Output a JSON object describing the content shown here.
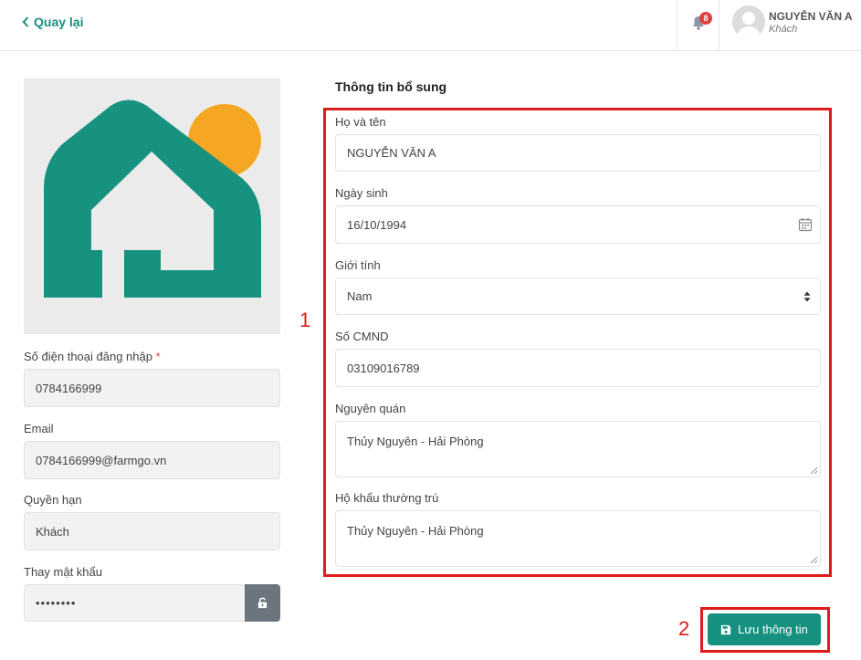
{
  "header": {
    "back_label": "Quay lại",
    "notification_count": "8",
    "user_name": "NGUYỄN VĂN A",
    "user_role": "Khách"
  },
  "left": {
    "phone": {
      "label": "Số điện thoại đăng nhập",
      "required_mark": "*",
      "value": "0784166999"
    },
    "email": {
      "label": "Email",
      "value": "0784166999@farmgo.vn"
    },
    "role": {
      "label": "Quyền hạn",
      "value": "Khách"
    },
    "password": {
      "label": "Thay mật khẩu",
      "value": "••••••••"
    }
  },
  "form": {
    "title": "Thông tin bổ sung",
    "full_name": {
      "label": "Họ và tên",
      "value": "NGUYỄN VĂN A"
    },
    "birthday": {
      "label": "Ngày sinh",
      "value": "16/10/1994"
    },
    "gender": {
      "label": "Giới tính",
      "value": "Nam"
    },
    "id_number": {
      "label": "Số CMND",
      "value": "03109016789"
    },
    "hometown": {
      "label": "Nguyên quán",
      "value": "Thủy Nguyên - Hải Phòng"
    },
    "residence": {
      "label": "Hộ khẩu thường trú",
      "value": "Thủy Nguyên - Hải Phòng"
    },
    "save_label": "Lưu thông tin"
  },
  "annotations": {
    "one": "1",
    "two": "2"
  },
  "colors": {
    "brand": "#16907f",
    "logo_sun": "#f5a623",
    "highlight": "#e01b1b"
  },
  "icons": [
    "chevron-left-icon",
    "bell-icon",
    "user-avatar-icon",
    "house-logo",
    "calendar-icon",
    "sort-arrows-icon",
    "unlock-icon",
    "save-icon"
  ]
}
